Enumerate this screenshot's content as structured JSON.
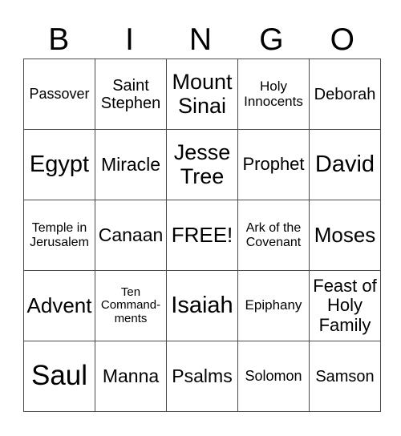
{
  "header": [
    "B",
    "I",
    "N",
    "G",
    "O"
  ],
  "rows": [
    [
      "Passover",
      "Saint Stephen",
      "Mount Sinai",
      "Holy Innocents",
      "Deborah"
    ],
    [
      "Egypt",
      "Miracle",
      "Jesse Tree",
      "Prophet",
      "David"
    ],
    [
      "Temple in Jerusalem",
      "Canaan",
      "FREE!",
      "Ark of the Covenant",
      "Moses"
    ],
    [
      "Advent",
      "Ten Command-ments",
      "Isaiah",
      "Epiphany",
      "Feast of Holy Family"
    ],
    [
      "Saul",
      "Manna",
      "Psalms",
      "Solomon",
      "Samson"
    ]
  ]
}
